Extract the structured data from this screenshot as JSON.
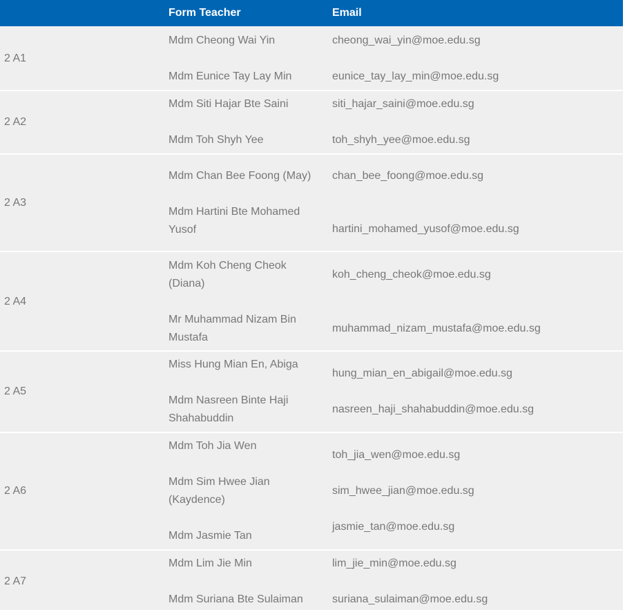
{
  "header": {
    "class_label": "",
    "teacher_label": "Form Teacher",
    "email_label": "Email"
  },
  "rows": [
    {
      "class": "2 A1",
      "teachers": [
        {
          "name": "Mdm Cheong Wai Yin",
          "email": "cheong_wai_yin@moe.edu.sg"
        },
        {
          "name": "Mdm Eunice Tay Lay Min",
          "email": "eunice_tay_lay_min@moe.edu.sg"
        }
      ]
    },
    {
      "class": "2 A2",
      "teachers": [
        {
          "name": "Mdm Siti Hajar Bte Saini",
          "email": "siti_hajar_saini@moe.edu.sg"
        },
        {
          "name": "Mdm Toh Shyh Yee",
          "email": "toh_shyh_yee@moe.edu.sg"
        }
      ]
    },
    {
      "class": "2 A3",
      "teachers": [
        {
          "name": "Mdm Chan Bee Foong (May)",
          "email": "chan_bee_foong@moe.edu.sg"
        },
        {
          "name_line1": "Mdm Hartini Bte Mohamed",
          "name_line2": "Yusof",
          "email": "hartini_mohamed_yusof@moe.edu.sg"
        }
      ]
    },
    {
      "class": "2 A4",
      "teachers": [
        {
          "name_line1": "Mdm Koh Cheng Cheok",
          "name_line2": "(Diana)",
          "email": "koh_cheng_cheok@moe.edu.sg"
        },
        {
          "name_line1": "Mr Muhammad Nizam Bin",
          "name_line2": "Mustafa",
          "email": "muhammad_nizam_mustafa@moe.edu.sg"
        }
      ]
    },
    {
      "class": "2 A5",
      "teachers": [
        {
          "name": "Miss Hung Mian En, Abiga",
          "email": "hung_mian_en_abigail@moe.edu.sg"
        },
        {
          "name_line1": "Mdm Nasreen Binte Haji",
          "name_line2": "Shahabuddin",
          "email": "nasreen_haji_shahabuddin@moe.edu.sg"
        }
      ]
    },
    {
      "class": "2 A6",
      "teachers": [
        {
          "name": "Mdm Toh Jia Wen",
          "email": "toh_jia_wen@moe.edu.sg"
        },
        {
          "name_line1": "Mdm Sim Hwee Jian",
          "name_line2": "(Kaydence)",
          "email": "sim_hwee_jian@moe.edu.sg"
        },
        {
          "name": "Mdm Jasmie Tan",
          "email": "jasmie_tan@moe.edu.sg"
        }
      ]
    },
    {
      "class": "2 A7",
      "teachers": [
        {
          "name": "Mdm Lim Jie Min",
          "email": "lim_jie_min@moe.edu.sg"
        },
        {
          "name": "Mdm Suriana Bte Sulaiman",
          "email": "suriana_sulaiman@moe.edu.sg"
        }
      ]
    }
  ]
}
